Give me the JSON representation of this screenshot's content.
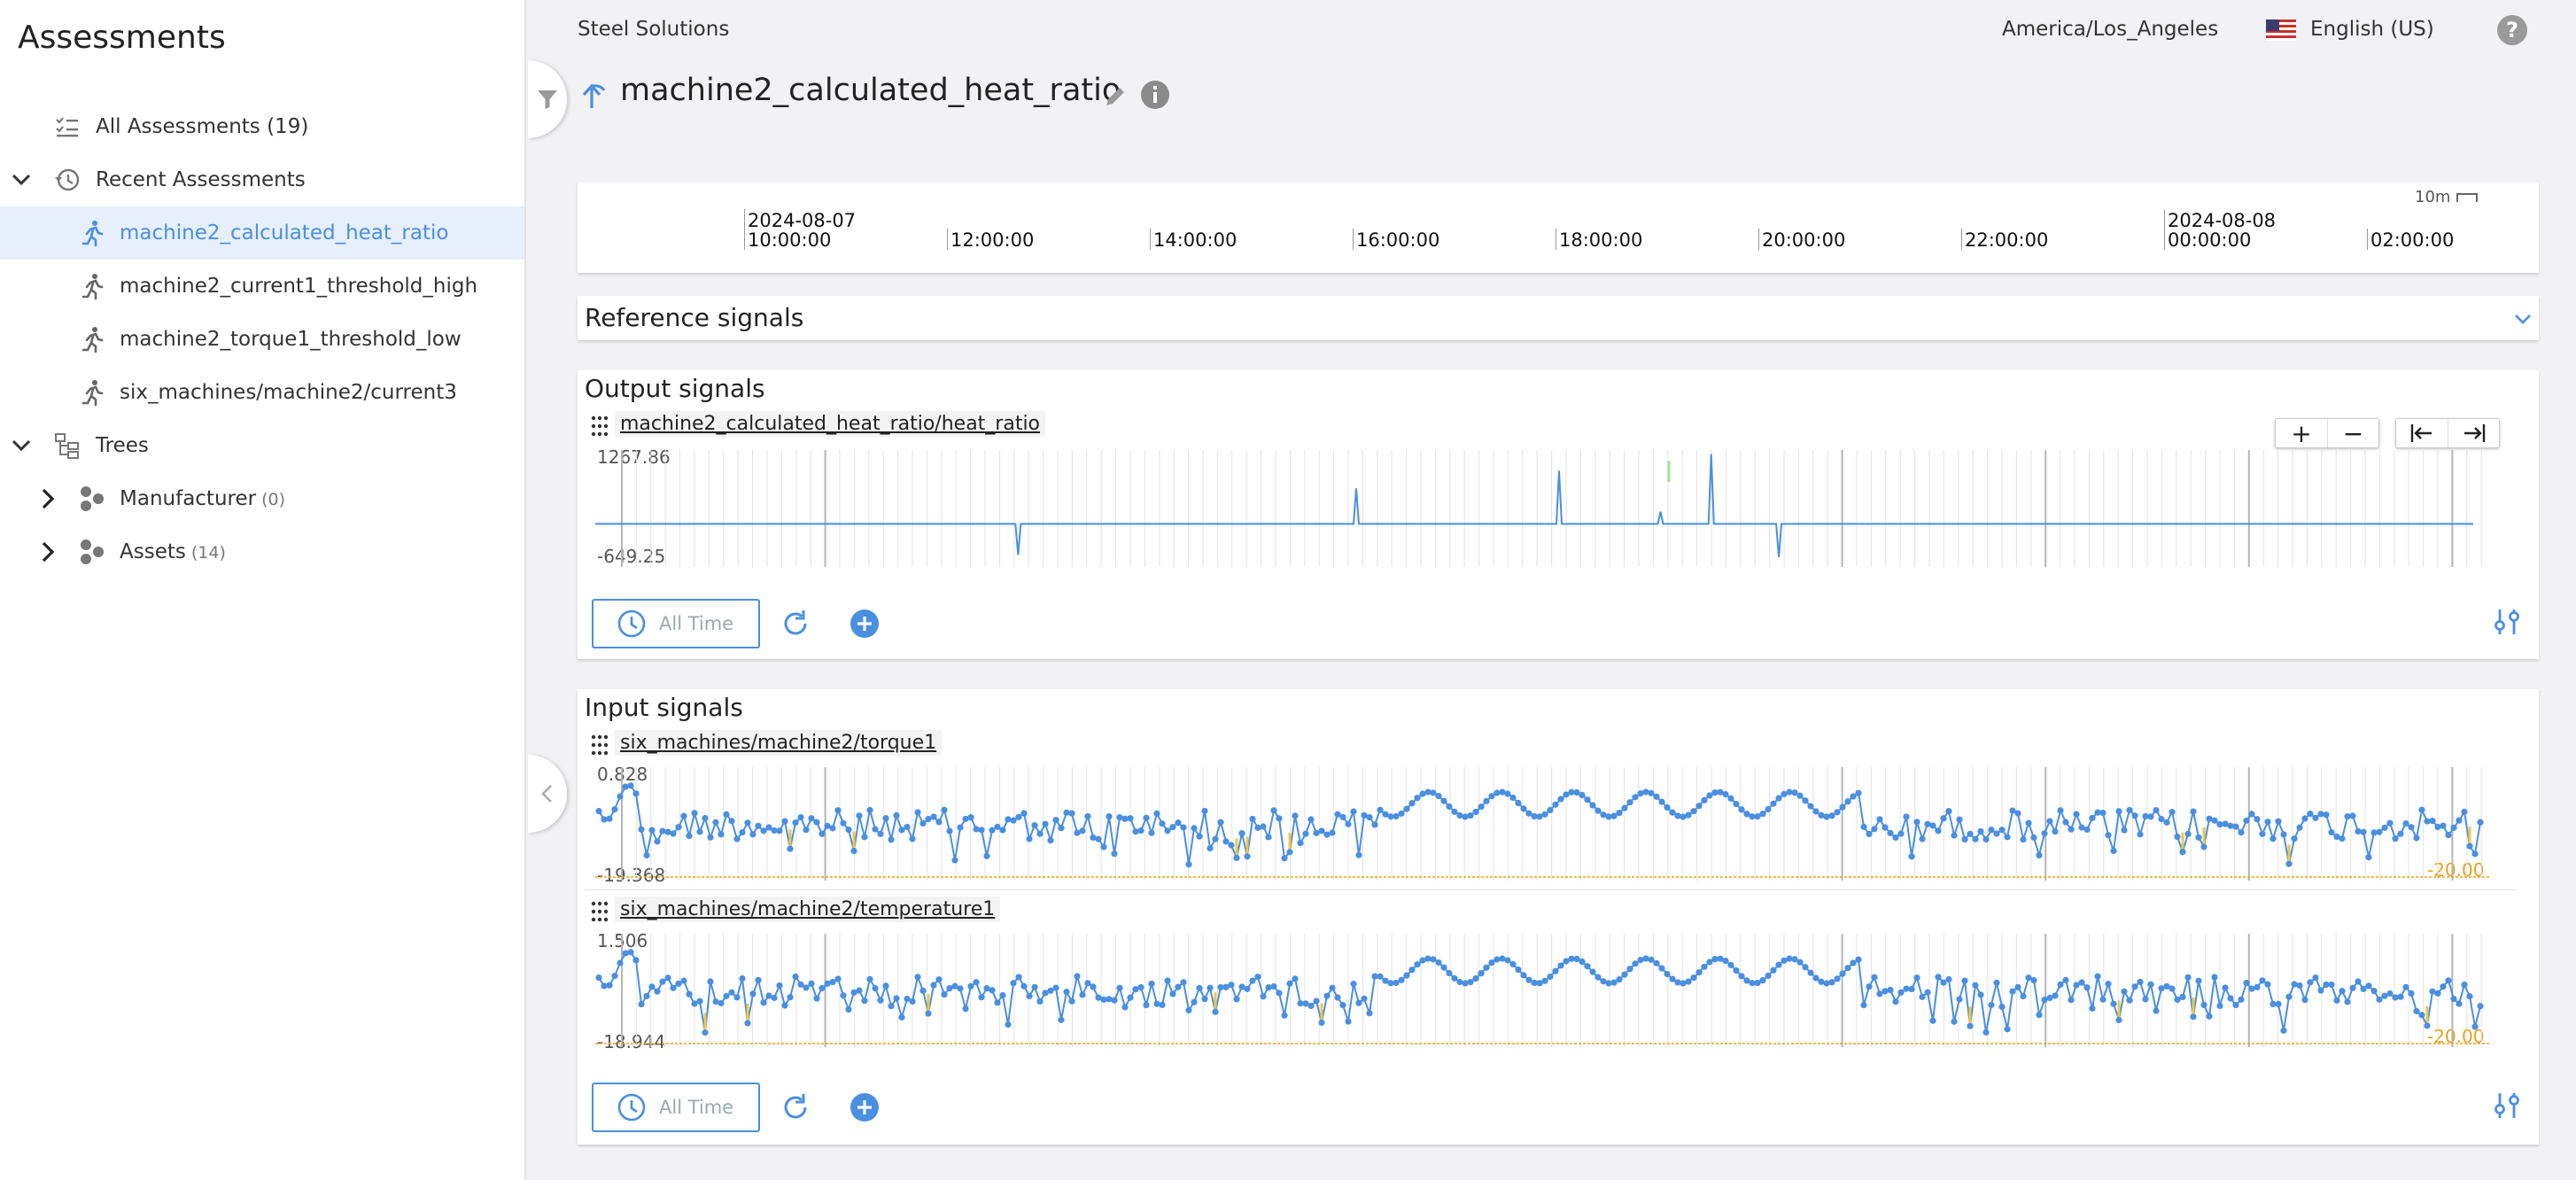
{
  "sidebar": {
    "title": "Assessments",
    "all_assessments": "All Assessments (19)",
    "recent_assessments": "Recent Assessments",
    "recent_items": [
      "machine2_calculated_heat_ratio",
      "machine2_current1_threshold_high",
      "machine2_torque1_threshold_low",
      "six_machines/machine2/current3"
    ],
    "trees": "Trees",
    "tree_items": [
      {
        "label": "Manufacturer",
        "count": "(0)"
      },
      {
        "label": "Assets",
        "count": "(14)"
      }
    ]
  },
  "header": {
    "company": "Steel Solutions",
    "timezone": "America/Los_Angeles",
    "language": "English (US)"
  },
  "page": {
    "title": "machine2_calculated_heat_ratio"
  },
  "timeline": {
    "scale_label": "10m",
    "ticks": [
      {
        "date": "2024-08-07",
        "time": "10:00:00"
      },
      {
        "date": "",
        "time": "12:00:00"
      },
      {
        "date": "",
        "time": "14:00:00"
      },
      {
        "date": "",
        "time": "16:00:00"
      },
      {
        "date": "",
        "time": "18:00:00"
      },
      {
        "date": "",
        "time": "20:00:00"
      },
      {
        "date": "",
        "time": "22:00:00"
      },
      {
        "date": "2024-08-08",
        "time": "00:00:00"
      },
      {
        "date": "",
        "time": "02:00:00"
      }
    ]
  },
  "reference": {
    "title": "Reference signals"
  },
  "output": {
    "title": "Output signals",
    "signal_name": "machine2_calculated_heat_ratio/heat_ratio",
    "ymax": "1267.86",
    "ymin": "-649.25",
    "time_button": "All Time",
    "zoom_in": "+",
    "zoom_out": "−"
  },
  "input": {
    "title": "Input signals",
    "signals": [
      {
        "name": "six_machines/machine2/torque1",
        "ymax": "0.828",
        "ymin": "-19.368",
        "threshold": "-20.00"
      },
      {
        "name": "six_machines/machine2/temperature1",
        "ymax": "1.506",
        "ymin": "-18.944",
        "threshold": "-20.00"
      }
    ],
    "time_button": "All Time"
  },
  "colors": {
    "accent": "#4a8fe0",
    "series": "#4a8fe0",
    "threshold": "#e8a01a",
    "marker_fill": "#f2c744"
  },
  "chart_data": [
    {
      "type": "line",
      "title": "machine2_calculated_heat_ratio/heat_ratio",
      "ylim": [
        -649.25,
        1267.86
      ],
      "x": [
        "2024-08-07 08:30",
        "2024-08-07 11:00",
        "2024-08-07 12:40",
        "2024-08-07 14:00",
        "2024-08-07 16:00",
        "2024-08-07 16:45",
        "2024-08-07 18:00",
        "2024-08-07 19:00",
        "2024-08-07 19:30",
        "2024-08-07 20:10",
        "2024-08-07 23:00",
        "2024-08-08 02:30"
      ],
      "series": [
        {
          "values": [
            0,
            0,
            -560,
            0,
            640,
            0,
            960,
            220,
            1260,
            -600,
            0,
            0
          ]
        }
      ]
    },
    {
      "type": "line",
      "title": "six_machines/machine2/torque1",
      "ylim": [
        -19.368,
        0.828
      ],
      "threshold": -20.0,
      "series": [
        {
          "name": "six_machines/machine2/torque1",
          "pattern": "noisy oscillation between about -18 and -3; smooth periodic waves between about -8 and 0 during the middle of the range"
        }
      ]
    },
    {
      "type": "line",
      "title": "six_machines/machine2/temperature1",
      "ylim": [
        -18.944,
        1.506
      ],
      "threshold": -20.0,
      "series": [
        {
          "name": "six_machines/machine2/temperature1",
          "pattern": "noisy oscillation between about -17 and -3; smooth periodic waves between about -6 and 0 during the middle of the range"
        }
      ]
    }
  ]
}
